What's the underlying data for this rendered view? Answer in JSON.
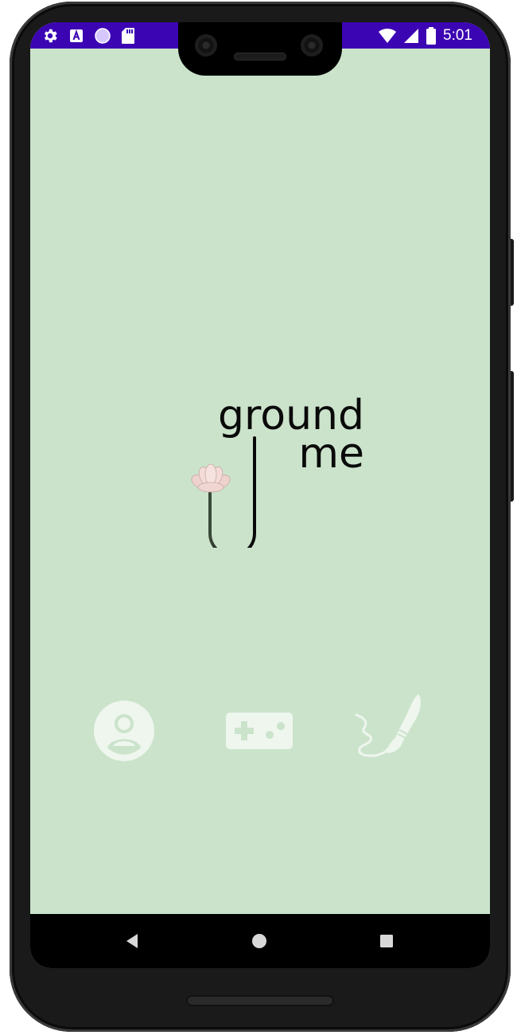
{
  "status_bar": {
    "time": "5:01",
    "left_icons": [
      "settings-icon",
      "text-a-icon",
      "circle-progress-icon",
      "sd-card-icon"
    ],
    "right_icons": [
      "wifi-icon",
      "signal-icon",
      "battery-icon"
    ],
    "background_color": "#3c05b3"
  },
  "app": {
    "background_color": "#cbe3cb",
    "logo": {
      "word1": "ground",
      "word2": "me",
      "flower_color": "#f1d6d3",
      "stem_color": "#7fa27f"
    },
    "actions": [
      {
        "name": "profile",
        "icon": "account-circle-icon"
      },
      {
        "name": "games",
        "icon": "gamepad-icon"
      },
      {
        "name": "draw",
        "icon": "paint-brush-icon"
      }
    ],
    "action_icon_color": "#eef6ee"
  },
  "nav_bar": {
    "buttons": [
      "back-icon",
      "home-icon",
      "recents-icon"
    ]
  }
}
